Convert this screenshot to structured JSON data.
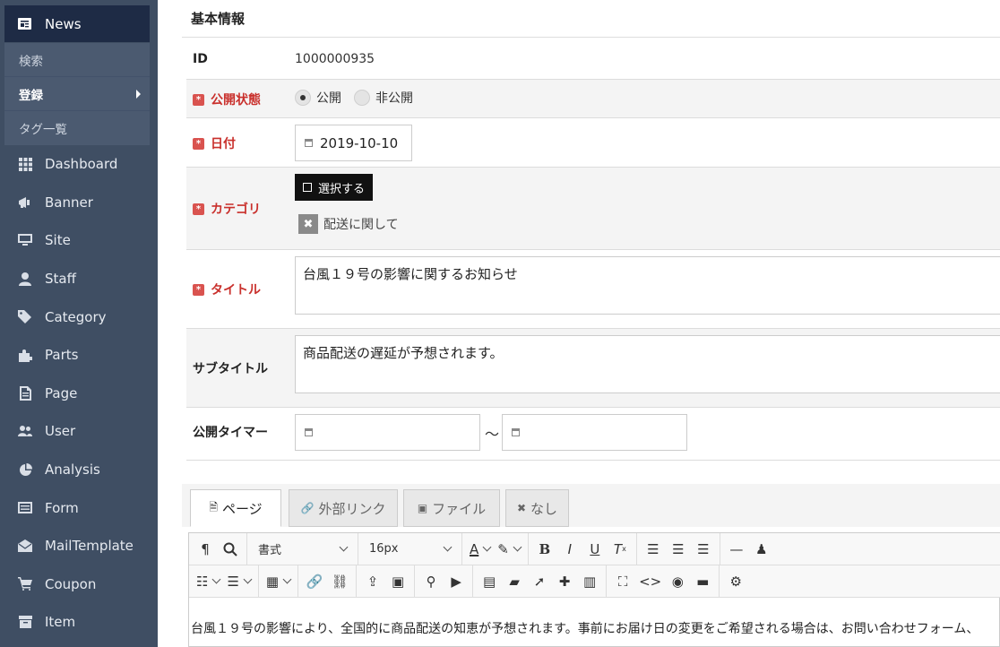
{
  "sidebar": {
    "news": {
      "label": "News",
      "icon": "news-icon"
    },
    "sub_items": [
      {
        "label": "検索"
      },
      {
        "label": "登録"
      },
      {
        "label": "タグ一覧"
      }
    ],
    "items": [
      {
        "label": "Dashboard",
        "icon": "grid-icon"
      },
      {
        "label": "Banner",
        "icon": "bullhorn-icon"
      },
      {
        "label": "Site",
        "icon": "monitor-icon"
      },
      {
        "label": "Staff",
        "icon": "user-icon"
      },
      {
        "label": "Category",
        "icon": "tags-icon"
      },
      {
        "label": "Parts",
        "icon": "puzzle-icon"
      },
      {
        "label": "Page",
        "icon": "page-icon"
      },
      {
        "label": "User",
        "icon": "users-icon"
      },
      {
        "label": "Analysis",
        "icon": "pie-chart-icon"
      },
      {
        "label": "Form",
        "icon": "form-icon"
      },
      {
        "label": "MailTemplate",
        "icon": "envelope-icon"
      },
      {
        "label": "Coupon",
        "icon": "cart-icon"
      },
      {
        "label": "Item",
        "icon": "box-icon"
      }
    ]
  },
  "form": {
    "section_title": "基本情報",
    "id": {
      "label": "ID",
      "value": "1000000935"
    },
    "status": {
      "label": "公開状態",
      "options": [
        "公開",
        "非公開"
      ],
      "selected": "公開"
    },
    "date": {
      "label": "日付",
      "value": "2019-10-10"
    },
    "category": {
      "label": "カテゴリ",
      "select_button": "選択する",
      "selected_chip": "配送に関して"
    },
    "title": {
      "label": "タイトル",
      "value": "台風１９号の影響に関するお知らせ"
    },
    "subtitle": {
      "label": "サブタイトル",
      "value": "商品配送の遅延が予想されます。"
    },
    "timer": {
      "label": "公開タイマー",
      "separator": "～",
      "start": "",
      "end": ""
    }
  },
  "tabs": [
    {
      "label": "ページ",
      "icon": "page-icon",
      "active": true
    },
    {
      "label": "外部リンク",
      "icon": "link-icon",
      "active": false
    },
    {
      "label": "ファイル",
      "icon": "image-icon",
      "active": false
    },
    {
      "label": "なし",
      "icon": "close-icon",
      "active": false
    }
  ],
  "editor": {
    "format_label": "書式",
    "size_label": "16px",
    "content": "台風１９号の影響により、全国的に商品配送の知恵が予想されます。事前にお届け日の変更をご希望される場合は、お問い合わせフォーム、"
  },
  "colors": {
    "sidebar_bg": "#3f4e63",
    "active_nav": "#1e2b45",
    "required": "#c9302c"
  }
}
